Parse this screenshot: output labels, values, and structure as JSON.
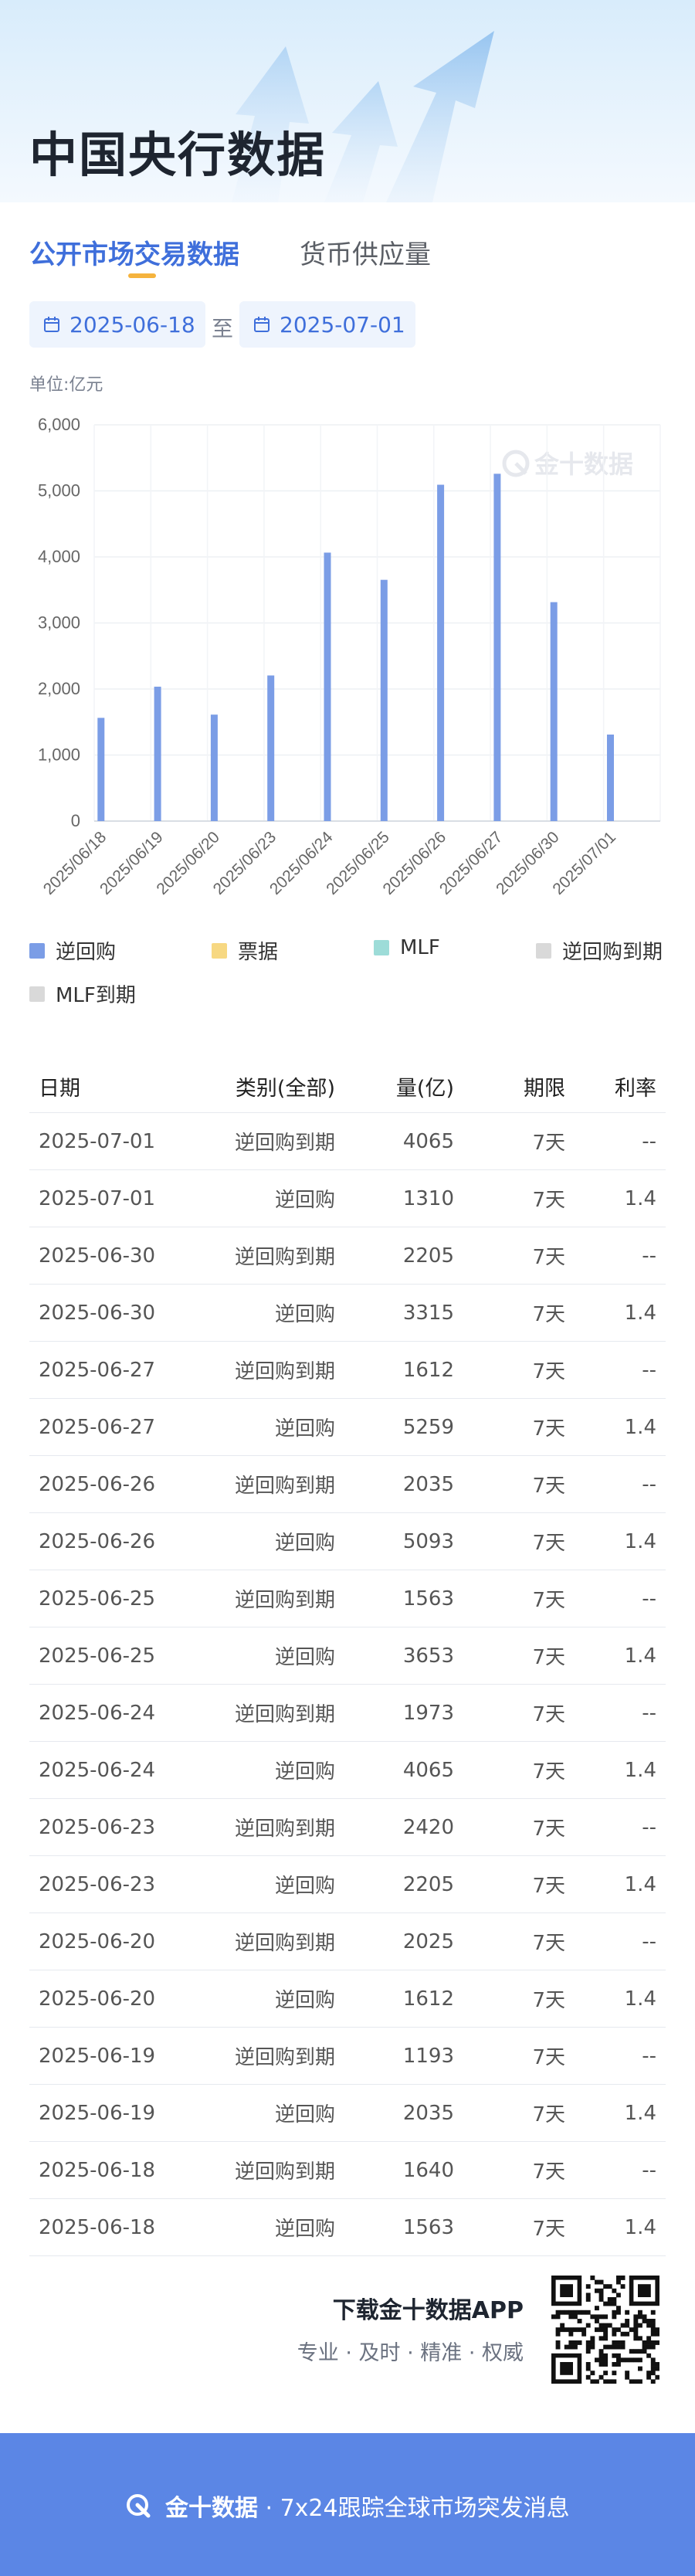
{
  "page": {
    "title": "中国央行数据"
  },
  "tabs": [
    {
      "label": "公开市场交易数据",
      "active": true
    },
    {
      "label": "货币供应量",
      "active": false
    }
  ],
  "date_range": {
    "start": "2025-06-18",
    "separator": "至",
    "end": "2025-07-01"
  },
  "unit_label": "单位:亿元",
  "watermark": "金十数据",
  "colors": {
    "accent": "#3f6fdb",
    "reverse_repo": "#7b9de6",
    "bills": "#f7d882",
    "mlf": "#9ddcd8",
    "maturity": "#d9d9d9",
    "footer": "#5b86e5"
  },
  "chart_data": {
    "type": "bar",
    "categories": [
      "2025/06/18",
      "2025/06/19",
      "2025/06/20",
      "2025/06/23",
      "2025/06/24",
      "2025/06/25",
      "2025/06/26",
      "2025/06/27",
      "2025/06/30",
      "2025/07/01"
    ],
    "series": [
      {
        "name": "逆回购",
        "values": [
          1563,
          2035,
          1612,
          2205,
          4065,
          3653,
          5093,
          5259,
          3315,
          1310
        ]
      }
    ],
    "ylim": [
      0,
      6000
    ],
    "yticks": [
      "0",
      "1,000",
      "2,000",
      "3,000",
      "4,000",
      "5,000",
      "6,000"
    ],
    "grid": true
  },
  "legend": [
    {
      "label": "逆回购",
      "color": "#7b9de6"
    },
    {
      "label": "票据",
      "color": "#f7d882"
    },
    {
      "label": "MLF",
      "color": "#9ddcd8"
    },
    {
      "label": "逆回购到期",
      "color": "#d9d9d9"
    },
    {
      "label": "MLF到期",
      "color": "#d9d9d9"
    }
  ],
  "table": {
    "headers": [
      "日期",
      "类别(全部)",
      "量(亿)",
      "期限",
      "利率"
    ],
    "rows": [
      [
        "2025-07-01",
        "逆回购到期",
        "4065",
        "7天",
        "--"
      ],
      [
        "2025-07-01",
        "逆回购",
        "1310",
        "7天",
        "1.4"
      ],
      [
        "2025-06-30",
        "逆回购到期",
        "2205",
        "7天",
        "--"
      ],
      [
        "2025-06-30",
        "逆回购",
        "3315",
        "7天",
        "1.4"
      ],
      [
        "2025-06-27",
        "逆回购到期",
        "1612",
        "7天",
        "--"
      ],
      [
        "2025-06-27",
        "逆回购",
        "5259",
        "7天",
        "1.4"
      ],
      [
        "2025-06-26",
        "逆回购到期",
        "2035",
        "7天",
        "--"
      ],
      [
        "2025-06-26",
        "逆回购",
        "5093",
        "7天",
        "1.4"
      ],
      [
        "2025-06-25",
        "逆回购到期",
        "1563",
        "7天",
        "--"
      ],
      [
        "2025-06-25",
        "逆回购",
        "3653",
        "7天",
        "1.4"
      ],
      [
        "2025-06-24",
        "逆回购到期",
        "1973",
        "7天",
        "--"
      ],
      [
        "2025-06-24",
        "逆回购",
        "4065",
        "7天",
        "1.4"
      ],
      [
        "2025-06-23",
        "逆回购到期",
        "2420",
        "7天",
        "--"
      ],
      [
        "2025-06-23",
        "逆回购",
        "2205",
        "7天",
        "1.4"
      ],
      [
        "2025-06-20",
        "逆回购到期",
        "2025",
        "7天",
        "--"
      ],
      [
        "2025-06-20",
        "逆回购",
        "1612",
        "7天",
        "1.4"
      ],
      [
        "2025-06-19",
        "逆回购到期",
        "1193",
        "7天",
        "--"
      ],
      [
        "2025-06-19",
        "逆回购",
        "2035",
        "7天",
        "1.4"
      ],
      [
        "2025-06-18",
        "逆回购到期",
        "1640",
        "7天",
        "--"
      ],
      [
        "2025-06-18",
        "逆回购",
        "1563",
        "7天",
        "1.4"
      ]
    ]
  },
  "download": {
    "title": "下载金十数据APP",
    "subtitle": "专业 · 及时 · 精准 · 权威"
  },
  "footer": {
    "brand": "金十数据",
    "tagline": "· 7x24跟踪全球市场突发消息"
  }
}
